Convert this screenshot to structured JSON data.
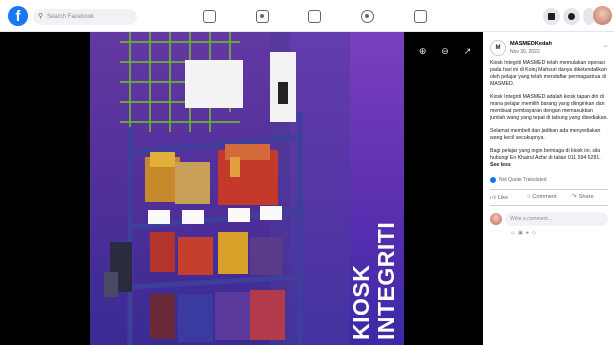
{
  "topbar": {
    "logo_letter": "f",
    "search_placeholder": "Search Facebook"
  },
  "photo": {
    "overlay_line1": "KIOSK",
    "overlay_line2": "INTEGRITI",
    "colors": {
      "purple": "#6a35b8",
      "shelf": "#3f3a8f"
    }
  },
  "post": {
    "author": "MASMEDKedah",
    "date": "Nov 30, 2022",
    "paragraphs": [
      "Kiosk Integriti MASMED telah memulakan operasi pada hari ini di Kolej Mahsuri danya diketendalikan oleh pelajar yang telah mendaftar permagastrua di MASMED.",
      "Kiosk Integriti MASMED adalah kiosk tapan diri di mana pelajar memilih barang yang diinginkan dan membuat pembayaran dengan memasukkan jumlah wang yang tepat di tabung yang disediakan.",
      "Selamat membeli dan jadikan ada menyediakan wang kecil secukupnya.",
      "Bagi pelajar yang ingin berniaga di kiosk ini, sila hubungi En Khairul Azfar di talian 011 594 6281."
    ],
    "see_less": "See less",
    "translation": "Not Quote Translated",
    "like_label": "Like",
    "comment_label": "Comment",
    "share_label": "Share",
    "comment_placeholder": "Write a comment..."
  }
}
